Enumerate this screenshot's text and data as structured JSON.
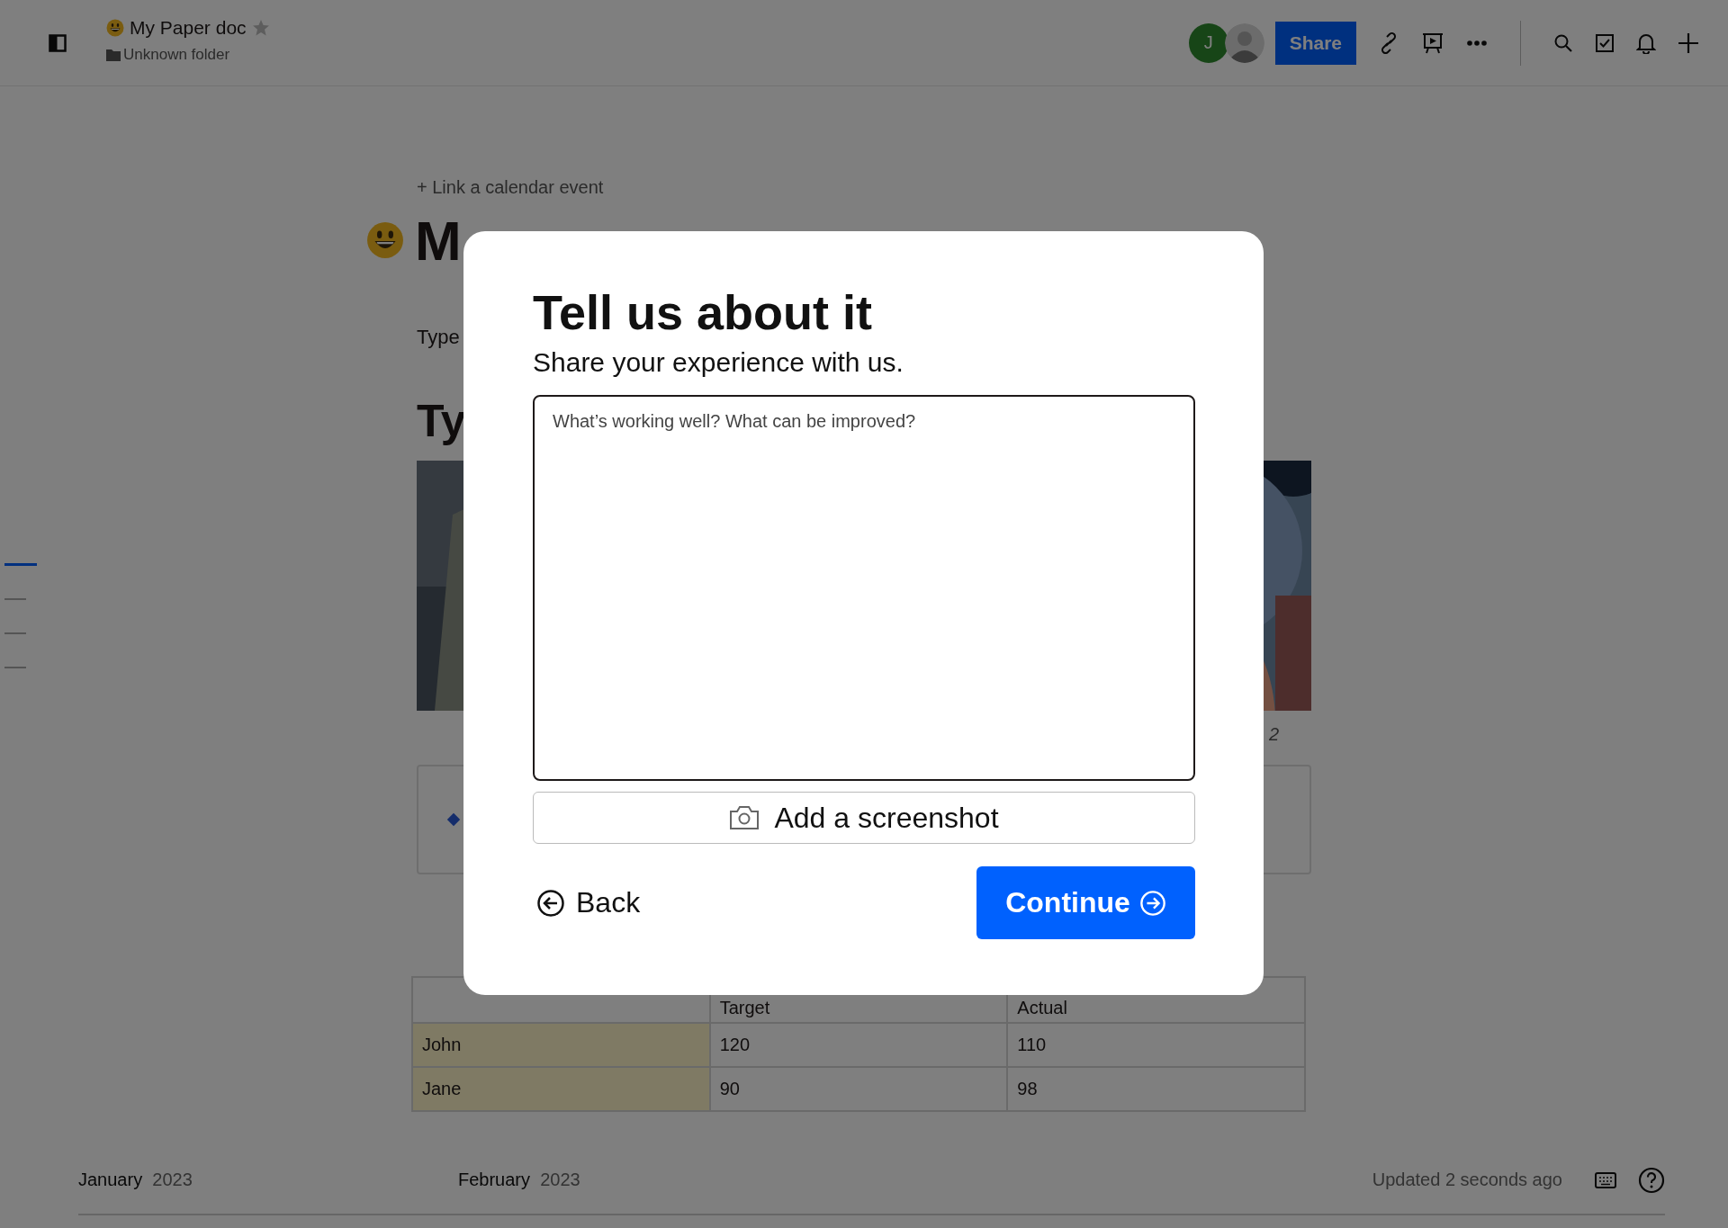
{
  "header": {
    "title": "My Paper doc",
    "folder": "Unknown folder"
  },
  "collaborators": [
    {
      "kind": "initial",
      "text": "J"
    },
    {
      "kind": "picture"
    }
  ],
  "share_button": "Share",
  "doc": {
    "calendar_link": "+ Link a calendar event",
    "title": "M",
    "body_text": "Type",
    "heading": "Ty",
    "caption": "2",
    "table": {
      "columns": [
        "Target",
        "Actual"
      ],
      "rows": [
        {
          "name": "John",
          "cells": [
            "120",
            "110"
          ]
        },
        {
          "name": "Jane",
          "cells": [
            "90",
            "98"
          ]
        }
      ]
    }
  },
  "outline": [
    {
      "selected": true
    },
    {
      "selected": false
    },
    {
      "selected": false
    },
    {
      "selected": false
    }
  ],
  "footer": {
    "months": [
      {
        "month": "January",
        "year": "2023"
      },
      {
        "month": "February",
        "year": "2023"
      }
    ],
    "updated": "Updated 2 seconds ago"
  },
  "modal": {
    "title": "Tell us about it",
    "subtitle": "Share your experience with us.",
    "placeholder": "What’s working well? What can be improved?",
    "screenshot_button": "Add a screenshot",
    "back_button": "Back",
    "continue_button": "Continue"
  }
}
